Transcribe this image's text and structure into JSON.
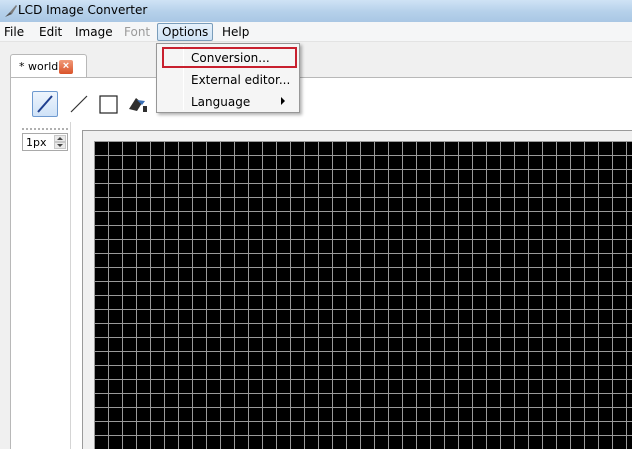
{
  "window": {
    "title": "LCD Image Converter"
  },
  "menubar": {
    "items": [
      "File",
      "Edit",
      "Image",
      "Font",
      "Options",
      "Help"
    ]
  },
  "document_tab": {
    "label": "* world",
    "close_icon": "close-x"
  },
  "toolbar": {
    "tools": [
      "pen-icon",
      "line-icon",
      "rectangle-icon",
      "fill-icon"
    ]
  },
  "side_panel": {
    "brush_size": "1px"
  },
  "options_menu": {
    "items": [
      {
        "label": "Conversion..."
      },
      {
        "label": "External editor..."
      },
      {
        "label": "Language",
        "has_submenu": true
      }
    ]
  },
  "colors": {
    "highlight_border": "#c8202e",
    "canvas_bg": "#000000",
    "grid_line": "#9a9a9a"
  }
}
